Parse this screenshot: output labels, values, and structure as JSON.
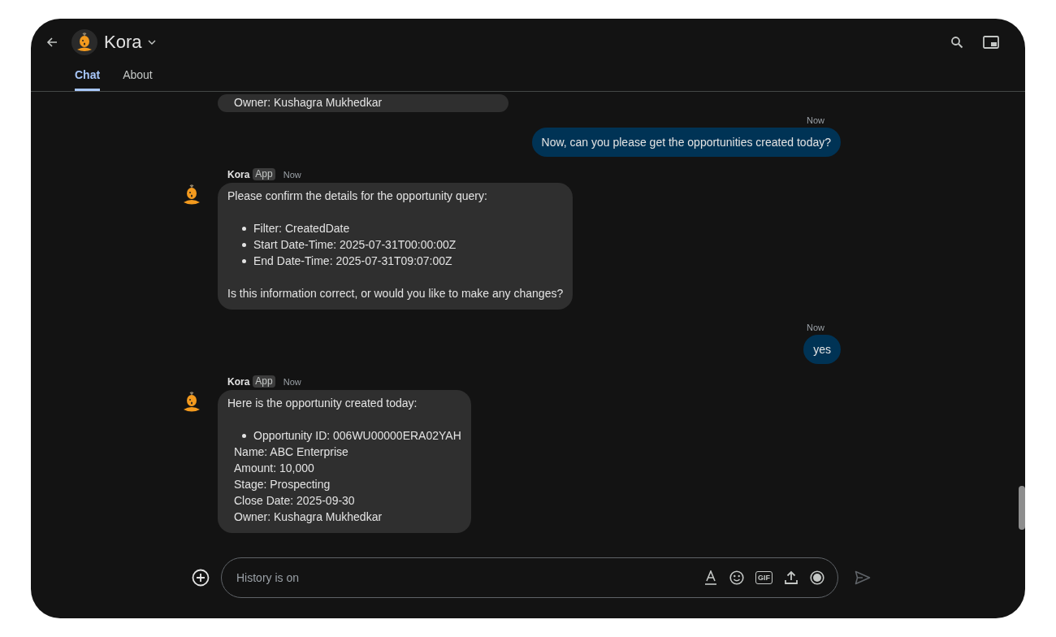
{
  "header": {
    "title": "Kora",
    "tabs": [
      {
        "label": "Chat",
        "selected": true
      },
      {
        "label": "About",
        "selected": false
      }
    ]
  },
  "messages": [
    {
      "kind": "bot_tail",
      "body": [
        {
          "kind": "lines",
          "lines": [
            "Owner: Kushagra Mukhedkar"
          ]
        }
      ]
    },
    {
      "kind": "user",
      "time": "Now",
      "text": "Now, can you please get the opportunities created today?"
    },
    {
      "kind": "bot",
      "sender": "Kora",
      "badge": "App",
      "time": "Now",
      "body": [
        {
          "kind": "text",
          "text": "Please confirm the details for the opportunity query:"
        },
        {
          "kind": "list",
          "items": [
            "Filter: CreatedDate",
            "Start Date-Time: 2025-07-31T00:00:00Z",
            "End Date-Time: 2025-07-31T09:07:00Z"
          ]
        },
        {
          "kind": "text",
          "text": "Is this information correct, or would you like to make any changes?"
        }
      ]
    },
    {
      "kind": "user",
      "time": "Now",
      "text": "yes"
    },
    {
      "kind": "bot",
      "sender": "Kora",
      "badge": "App",
      "time": "Now",
      "body": [
        {
          "kind": "text",
          "text": "Here is the opportunity created today:"
        },
        {
          "kind": "list",
          "items": [
            "Opportunity ID: 006WU00000ERA02YAH"
          ]
        },
        {
          "kind": "lines",
          "lines": [
            "Name: ABC Enterprise",
            "Amount: 10,000",
            "Stage: Prospecting",
            "Close Date: 2025-09-30",
            "Owner: Kushagra Mukhedkar"
          ]
        }
      ]
    }
  ],
  "composer": {
    "placeholder": "History is on",
    "gif_label": "GIF",
    "send_disabled": true
  }
}
